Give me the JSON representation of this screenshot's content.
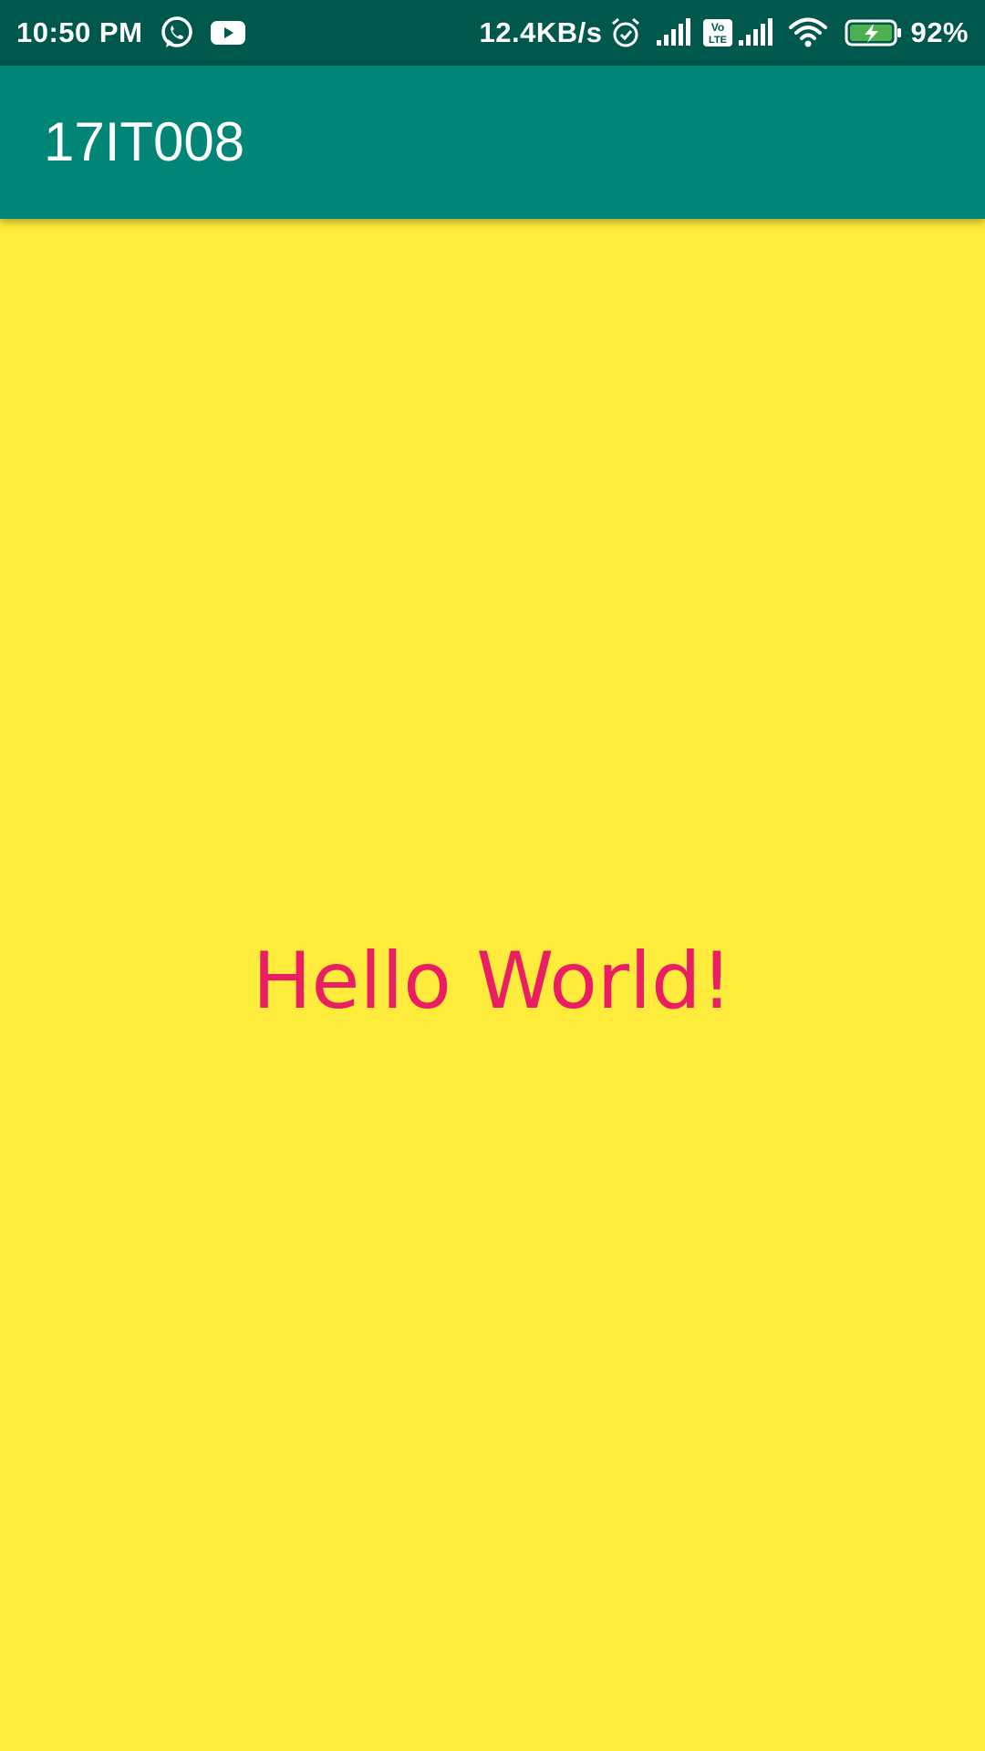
{
  "status_bar": {
    "time": "10:50 PM",
    "network_speed": "12.4KB/s",
    "battery_percent": "92%",
    "icons_left": [
      "whatsapp-icon",
      "youtube-icon"
    ],
    "icons_right": [
      "alarm-icon",
      "signal-icon",
      "volte-icon",
      "signal-icon",
      "wifi-icon",
      "battery-charging-icon"
    ],
    "volte_label_top": "Vo",
    "volte_label_bottom": "LTE",
    "background_color": "#00574b"
  },
  "app_bar": {
    "title": "17IT008",
    "background_color": "#008577"
  },
  "content": {
    "message": "Hello World!",
    "message_color": "#e91e63",
    "background_color": "#ffeb3b"
  }
}
